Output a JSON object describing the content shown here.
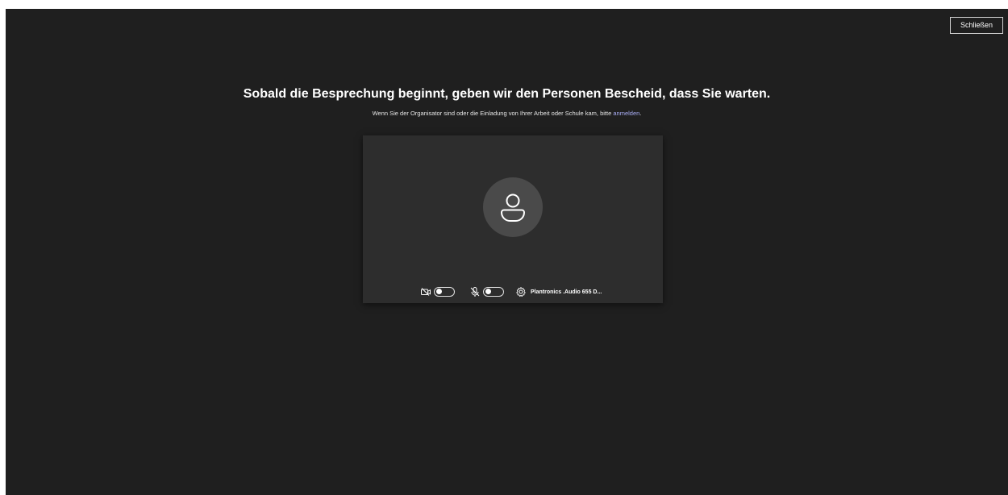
{
  "header": {
    "close_label": "Schließen"
  },
  "main": {
    "headline": "Sobald die Besprechung beginnt, geben wir den Personen Bescheid, dass Sie warten.",
    "subline_prefix": "Wenn Sie der Organisator sind oder die Einladung von Ihrer Arbeit oder Schule kam, bitte ",
    "signin_link": "anmelden",
    "subline_suffix": "."
  },
  "preview": {
    "avatar_icon": "person-icon",
    "camera_icon": "camera-off-icon",
    "camera_enabled": false,
    "mic_icon": "mic-off-icon",
    "mic_enabled": false,
    "settings_icon": "gear-icon",
    "device_label": "Plantronics .Audio 655 D..."
  },
  "colors": {
    "background": "#1f1f1f",
    "panel": "#2d2d2d",
    "avatar_circle": "#4a4a4a",
    "link": "#a9aef5",
    "text": "#ffffff"
  }
}
